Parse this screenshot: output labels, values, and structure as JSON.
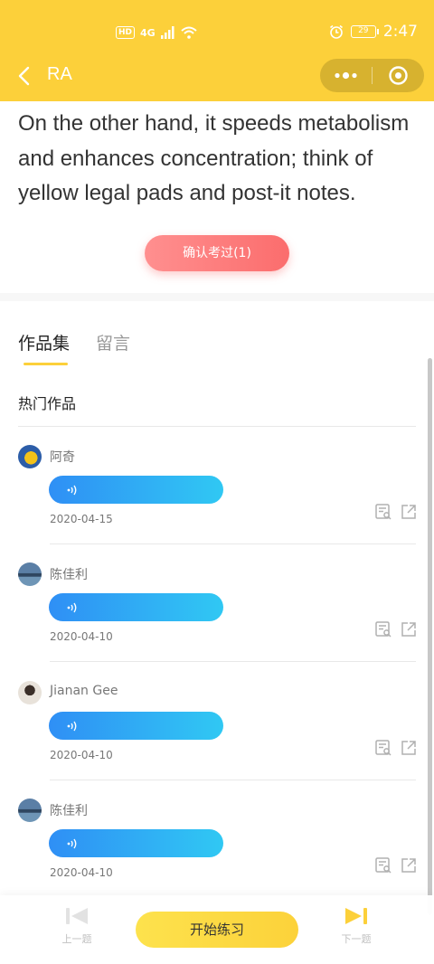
{
  "status_bar": {
    "network_badge": "HD",
    "network_type": "4G",
    "battery": "29",
    "time": "2:47"
  },
  "nav": {
    "title": "RA"
  },
  "passage": {
    "text": "On the other hand, it speeds metabolism and enhances concentration; think of yellow legal pads and post-it notes."
  },
  "confirm_button": {
    "label": "确认考过(1)"
  },
  "tabs": [
    {
      "label": "作品集",
      "active": true
    },
    {
      "label": "留言",
      "active": false
    }
  ],
  "hot_works": {
    "title": "热门作品",
    "items": [
      {
        "name": "阿奇",
        "date": "2020-04-15"
      },
      {
        "name": "陈佳利",
        "date": "2020-04-10"
      },
      {
        "name": "Jianan Gee",
        "date": "2020-04-10"
      },
      {
        "name": "陈佳利",
        "date": "2020-04-10"
      }
    ]
  },
  "bottom_bar": {
    "prev_label": "上一题",
    "start_label": "开始练习",
    "next_label": "下一题"
  },
  "colors": {
    "brand_yellow": "#fcd03a",
    "audio_blue": "#30a8f4",
    "confirm_red": "#fb6d6d"
  },
  "icons": {
    "back": "chevron-left-icon",
    "more": "more-dots-icon",
    "close": "target-circle-icon",
    "audio": "sound-wave-icon",
    "detail": "document-detail-icon",
    "share": "share-icon",
    "prev": "previous-icon",
    "next": "next-icon"
  }
}
